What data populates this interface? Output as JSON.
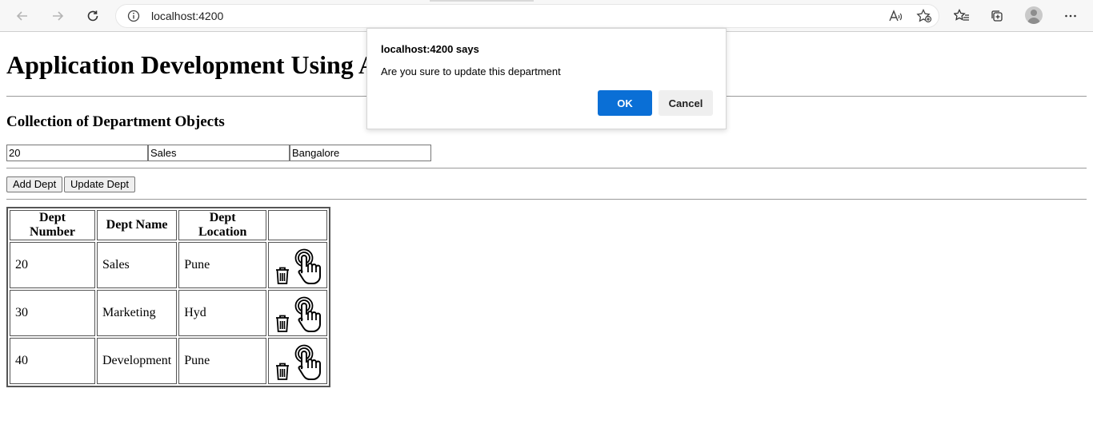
{
  "browser": {
    "url": "localhost:4200",
    "read_aloud_label": "A̅"
  },
  "page": {
    "heading": "Application Development Using A",
    "subheading": "Collection of Department Objects",
    "inputs": {
      "dept_number": "20",
      "dept_name": "Sales",
      "dept_location": "Bangalore"
    },
    "buttons": {
      "add": "Add Dept",
      "update": "Update Dept"
    },
    "table": {
      "headers": [
        "Dept Number",
        "Dept Name",
        "Dept Location",
        ""
      ],
      "rows": [
        {
          "number": "20",
          "name": "Sales",
          "location": "Pune"
        },
        {
          "number": "30",
          "name": "Marketing",
          "location": "Hyd"
        },
        {
          "number": "40",
          "name": "Development",
          "location": "Pune"
        }
      ]
    }
  },
  "dialog": {
    "title": "localhost:4200 says",
    "message": "Are you sure to update this department",
    "ok_label": "OK",
    "cancel_label": "Cancel"
  },
  "colors": {
    "dialog_ok_bg": "#0a6fd6",
    "toolbar_bg": "#f7f7f7"
  },
  "icons": [
    "back-icon",
    "forward-icon",
    "refresh-icon",
    "info-icon",
    "read-aloud-icon",
    "add-favorite-icon",
    "favorites-icon",
    "collections-icon",
    "profile-icon",
    "more-icon",
    "trash-icon",
    "hand-pointer-icon"
  ]
}
